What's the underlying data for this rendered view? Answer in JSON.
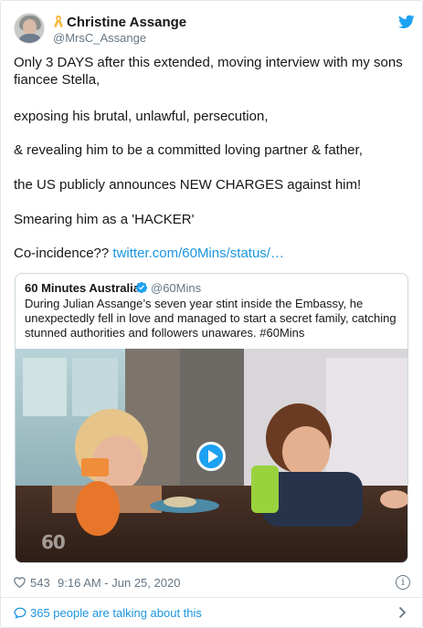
{
  "tweet": {
    "author_name": "Christine Assange",
    "author_handle": "@MrsC_Assange",
    "paragraphs": [
      "Only 3 DAYS after this extended, moving interview with my sons fiancee Stella,",
      "exposing his brutal, unlawful, persecution,",
      "& revealing him to be a committed loving partner & father,",
      "the US publicly announces NEW CHARGES against him!",
      "Smearing him as a 'HACKER'"
    ],
    "last_line_text": "Co-incidence?? ",
    "last_line_link": "twitter.com/60Mins/status/…",
    "likes": "543",
    "timestamp": "9:16 AM - Jun 25, 2020",
    "talking": "365 people are talking about this"
  },
  "quoted": {
    "name": "60 Minutes Australia",
    "handle": "@60Mins",
    "text": "During Julian Assange’s seven year stint inside the Embassy, he unexpectedly fell in love and managed to start a secret family, catching stunned authorities and followers unawares. #60Mins",
    "video_watermark": "60"
  },
  "colors": {
    "link": "#1b95e0",
    "twitter_blue": "#1da1f2",
    "text": "#14171a",
    "muted": "#657786"
  },
  "icons": [
    "ribbon-icon",
    "twitter-bird-icon",
    "verified-icon",
    "play-icon",
    "heart-icon",
    "info-icon",
    "speech-bubble-icon",
    "chevron-right-icon"
  ]
}
